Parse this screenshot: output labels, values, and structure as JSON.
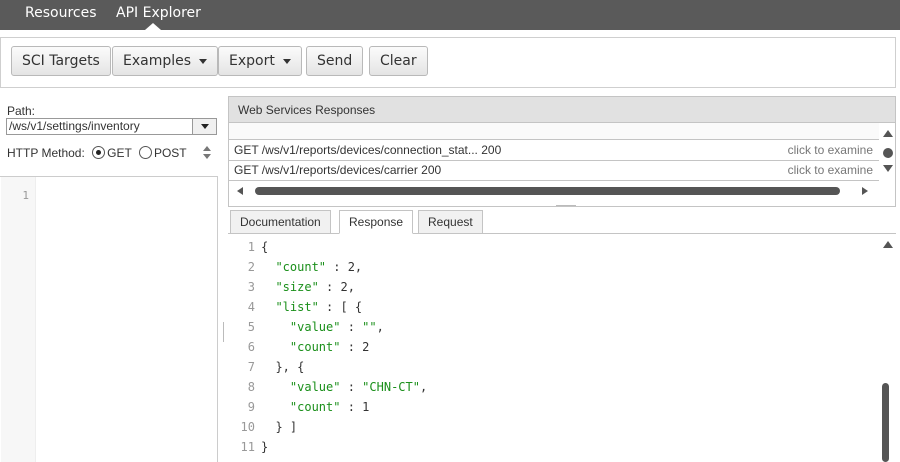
{
  "nav": {
    "tabs": [
      "Resources",
      "API Explorer"
    ]
  },
  "toolbar": {
    "sci_targets": "SCI Targets",
    "examples": "Examples",
    "export": "Export",
    "send": "Send",
    "clear": "Clear"
  },
  "left": {
    "path_label": "Path:",
    "path_value": "/ws/v1/settings/inventory",
    "method_label": "HTTP Method:",
    "methods": [
      "GET",
      "POST"
    ],
    "selected_method": "GET",
    "editor_line": "1"
  },
  "responses": {
    "title": "Web Services Responses",
    "rows": [
      {
        "text": "GET /ws/v1/reports/devices/connection_stat... 200",
        "action": "click to examine"
      },
      {
        "text": "GET /ws/v1/reports/devices/carrier 200",
        "action": "click to examine"
      }
    ]
  },
  "tabs": [
    "Documentation",
    "Response",
    "Request"
  ],
  "active_tab": "Response",
  "code_lines": [
    {
      "n": "1",
      "t": "{"
    },
    {
      "n": "2",
      "t": "  \"count\" : 2,"
    },
    {
      "n": "3",
      "t": "  \"size\" : 2,"
    },
    {
      "n": "4",
      "t": "  \"list\" : [ {"
    },
    {
      "n": "5",
      "t": "    \"value\" : \"\","
    },
    {
      "n": "6",
      "t": "    \"count\" : 2"
    },
    {
      "n": "7",
      "t": "  }, {"
    },
    {
      "n": "8",
      "t": "    \"value\" : \"CHN-CT\","
    },
    {
      "n": "9",
      "t": "    \"count\" : 1"
    },
    {
      "n": "10",
      "t": "  } ]"
    },
    {
      "n": "11",
      "t": "}"
    }
  ]
}
